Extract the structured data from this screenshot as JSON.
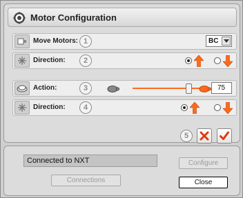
{
  "window": {
    "title": "Motor Configuration",
    "title_icon": "gear-icon"
  },
  "rows": {
    "move_motors": {
      "label": "Move Motors:",
      "step": "1",
      "icon": "motor-icon",
      "selected_port": "BC"
    },
    "direction1": {
      "label": "Direction:",
      "step": "2",
      "icon": "direction-icon",
      "selected": "forward"
    },
    "action": {
      "label": "Action:",
      "step": "3",
      "icon": "action-icon",
      "slider_value": 75,
      "slider_min": 0,
      "slider_max": 100,
      "value_text": "75"
    },
    "direction2": {
      "label": "Direction:",
      "step": "4",
      "icon": "direction-icon",
      "selected": "forward"
    }
  },
  "actions": {
    "step": "5",
    "cancel_icon": "x-icon",
    "ok_icon": "check-icon"
  },
  "status": {
    "connection_text": "Connected to NXT",
    "connections_label": "Connections",
    "configure_label": "Configure",
    "close_label": "Close"
  },
  "colors": {
    "accent": "#ff6a1a",
    "cancel_red": "#e03a10"
  }
}
